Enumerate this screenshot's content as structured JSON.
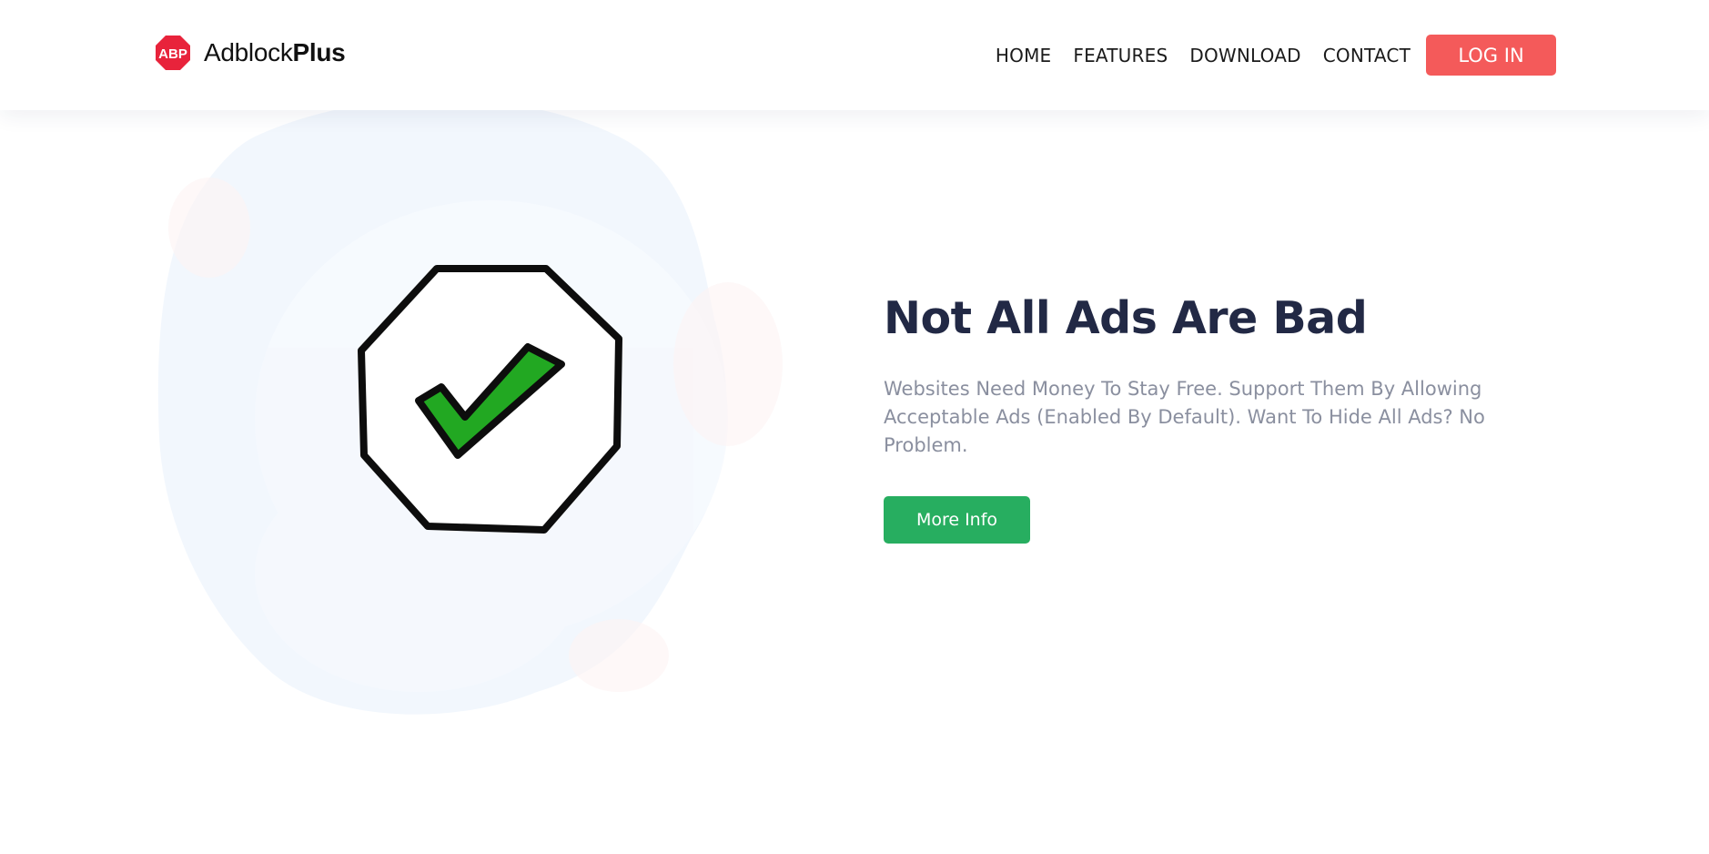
{
  "brand": {
    "badge_text": "ABP",
    "name_regular": "Adblock",
    "name_bold": "Plus",
    "badge_color": "#e8233b"
  },
  "nav": {
    "items": [
      {
        "label": "HOME"
      },
      {
        "label": "FEATURES"
      },
      {
        "label": "DOWNLOAD"
      },
      {
        "label": "CONTACT"
      }
    ],
    "login_label": "LOG IN",
    "login_color": "#f45a5a"
  },
  "hero": {
    "icon": "checkmark-octagon-icon",
    "title": "Not All Ads Are Bad",
    "description": "Websites Need Money To Stay Free. Support Them By Allowing Acceptable Ads (Enabled By Default). Want To Hide All Ads? No Problem.",
    "button_label": "More Info",
    "button_color": "#27ae60",
    "check_color": "#22a822"
  }
}
